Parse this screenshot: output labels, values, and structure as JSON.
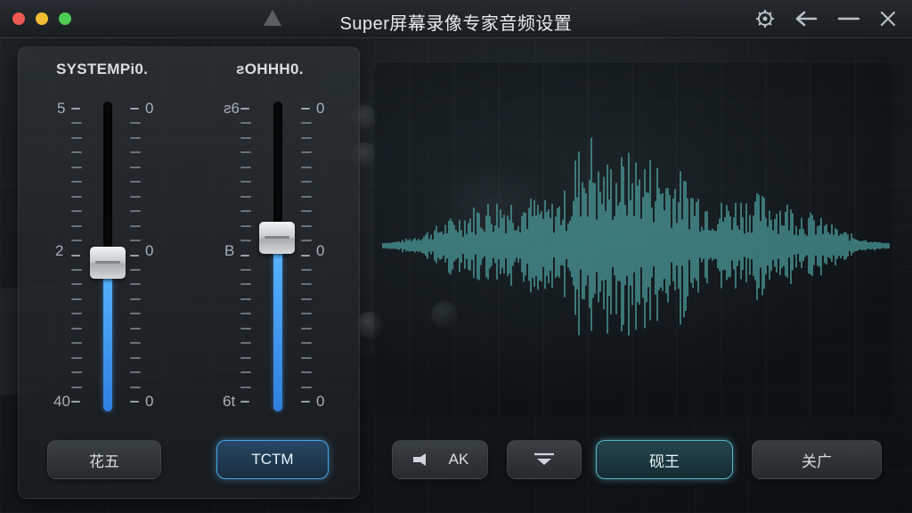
{
  "window": {
    "title": "Super屏幕录像专家音频设置",
    "accent_color": "#4aa6e8",
    "wave_color": "#4fa3a3"
  },
  "titlebar_icons": [
    "red-close-dot",
    "yellow-minimize-dot",
    "green-zoom-dot",
    "app-logo-icon",
    "gear-icon",
    "back-arrow-icon",
    "minimize-icon",
    "close-icon"
  ],
  "mixer": {
    "channels": [
      {
        "title": "SYSTEMPi0.",
        "left_labels": [
          "5",
          "2",
          "40"
        ],
        "right_labels": [
          "0",
          "0",
          "0"
        ],
        "level": 0.48
      },
      {
        "title": "ƨOHHH0.",
        "left_labels": [
          "ƨ6",
          "B",
          "6t"
        ],
        "right_labels": [
          "0",
          "0",
          "0"
        ],
        "level": 0.56
      }
    ],
    "buttons": [
      "花五",
      "TCTM"
    ]
  },
  "waveform": {
    "label": "",
    "buttons": [
      "AK",
      "",
      "砚王",
      "关广"
    ]
  }
}
